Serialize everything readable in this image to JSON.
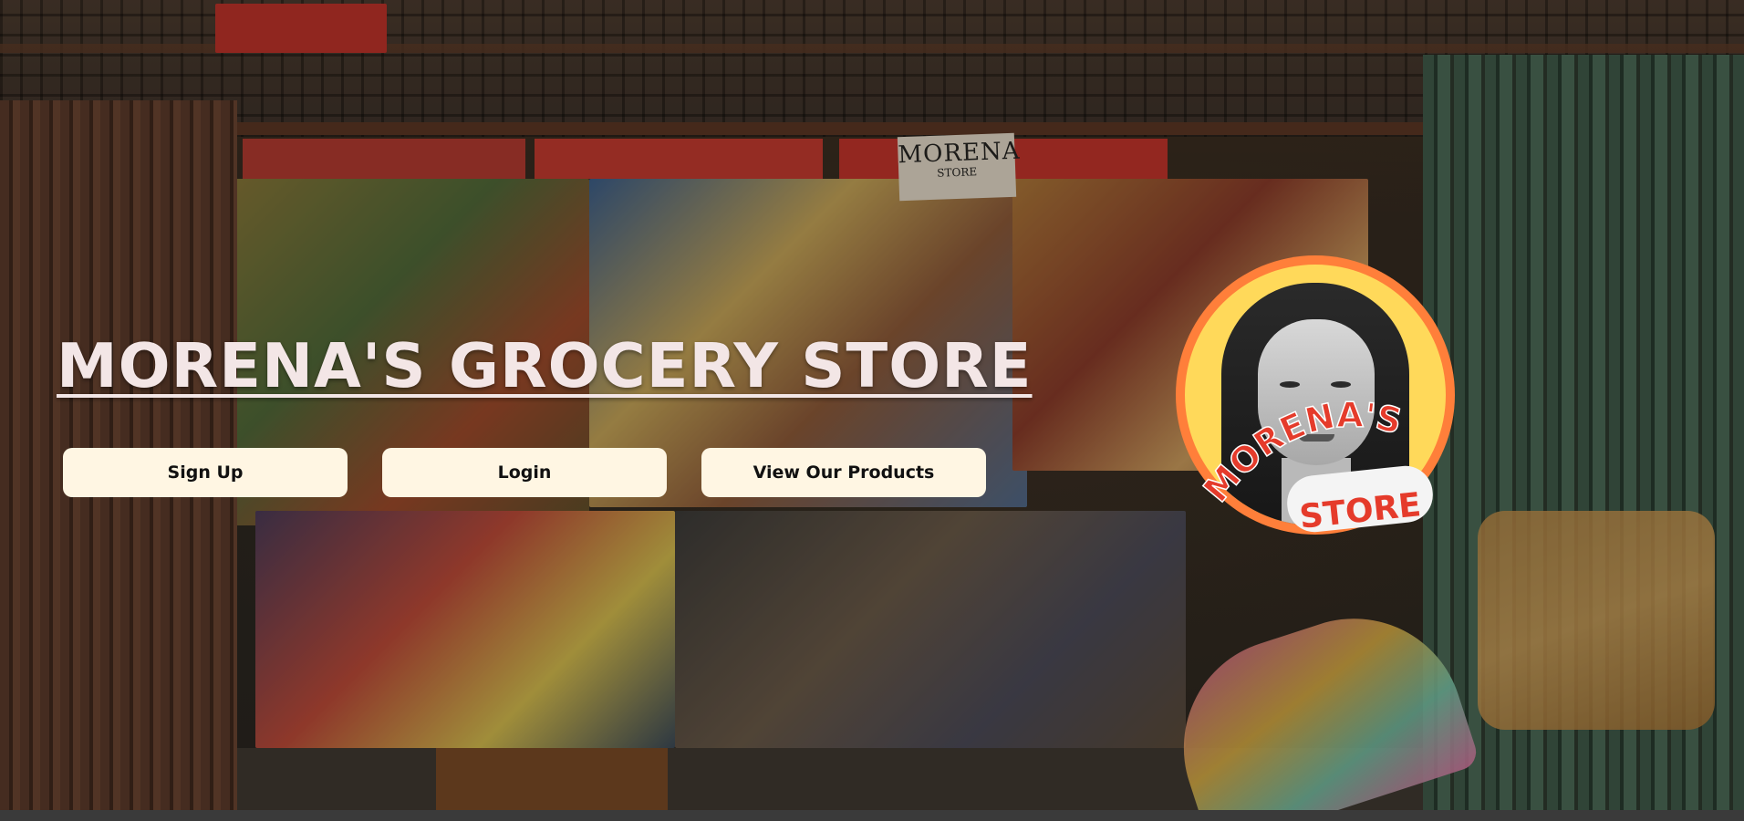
{
  "page": {
    "title": "MORENA'S GROCERY STORE"
  },
  "buttons": {
    "signup_label": "Sign Up",
    "login_label": "Login",
    "products_label": "View Our Products"
  },
  "logo": {
    "line1": "MORENA'S",
    "line2": "STORE"
  },
  "background_sign": {
    "big": "MORENA",
    "small": "STORE"
  },
  "colors": {
    "title": "#f3e6e6",
    "button_bg": "#fff6e3",
    "logo_ring": "#ff7f3a",
    "logo_fill": "#ffd95a",
    "logo_text": "#e53b2b"
  }
}
